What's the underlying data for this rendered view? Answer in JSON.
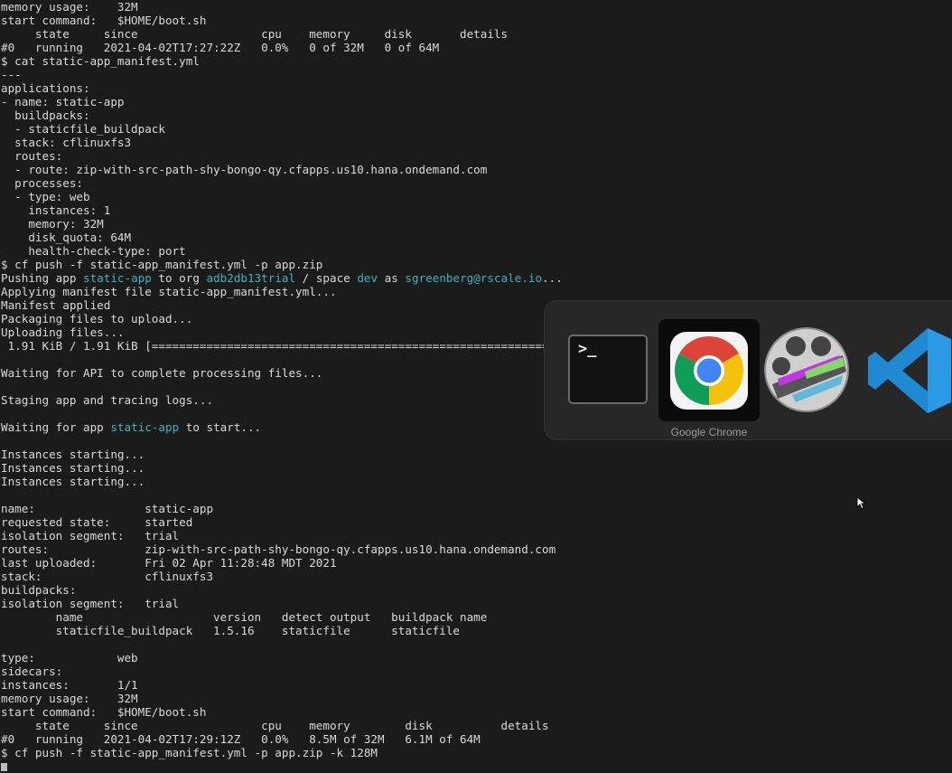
{
  "terminal": {
    "lines": [
      "memory usage:    32M",
      "start command:   $HOME/boot.sh",
      "     state     since                  cpu    memory     disk       details",
      "#0   running   2021-04-02T17:27:22Z   0.0%   0 of 32M   0 of 64M",
      "$ cat static-app_manifest.yml",
      "---",
      "applications:",
      "- name: static-app",
      "  buildpacks:",
      "  - staticfile_buildpack",
      "  stack: cflinuxfs3",
      "  routes:",
      "  - route: zip-with-src-path-shy-bongo-qy.cfapps.us10.hana.ondemand.com",
      "  processes:",
      "  - type: web",
      "    instances: 1",
      "    memory: 32M",
      "    disk_quota: 64M",
      "    health-check-type: port",
      "$ cf push -f static-app_manifest.yml -p app.zip",
      [
        [
          "Pushing app ",
          0
        ],
        [
          "static-app",
          1
        ],
        [
          " to org ",
          0
        ],
        [
          "adb2db13trial",
          1
        ],
        [
          " / space ",
          0
        ],
        [
          "dev",
          1
        ],
        [
          " as ",
          0
        ],
        [
          "sgreenberg@rscale.io",
          1
        ],
        [
          "...",
          0
        ]
      ],
      "Applying manifest file static-app_manifest.yml...",
      "Manifest applied",
      "Packaging files to upload...",
      "Uploading files...",
      " 1.91 KiB / 1.91 KiB [=============================================================================",
      "",
      "Waiting for API to complete processing files...",
      "",
      "Staging app and tracing logs...",
      "",
      [
        [
          "Waiting for app ",
          0
        ],
        [
          "static-app",
          1
        ],
        [
          " to start...",
          0
        ]
      ],
      "",
      "Instances starting...",
      "Instances starting...",
      "Instances starting...",
      "",
      "name:                static-app",
      "requested state:     started",
      "isolation segment:   trial",
      "routes:              zip-with-src-path-shy-bongo-qy.cfapps.us10.hana.ondemand.com",
      "last uploaded:       Fri 02 Apr 11:28:48 MDT 2021",
      "stack:               cflinuxfs3",
      "buildpacks:",
      "isolation segment:   trial",
      "        name                   version   detect output   buildpack name",
      "        staticfile_buildpack   1.5.16    staticfile      staticfile",
      "",
      "type:            web",
      "sidecars:",
      "instances:       1/1",
      "memory usage:    32M",
      "start command:   $HOME/boot.sh",
      "     state     since                  cpu    memory        disk          details",
      "#0   running   2021-04-02T17:29:12Z   0.0%   8.5M of 32M   6.1M of 64M",
      "$ cf push -f static-app_manifest.yml -p app.zip -k 128M"
    ]
  },
  "app_switcher": {
    "selected_label": "Google Chrome",
    "apps": [
      "terminal",
      "google-chrome",
      "claquette",
      "visual-studio-code"
    ],
    "terminal_prompt_glyph": ">_"
  },
  "colors": {
    "background": "#1b1b1b",
    "text": "#d9d9d9",
    "highlight": "#3fb3bb"
  }
}
